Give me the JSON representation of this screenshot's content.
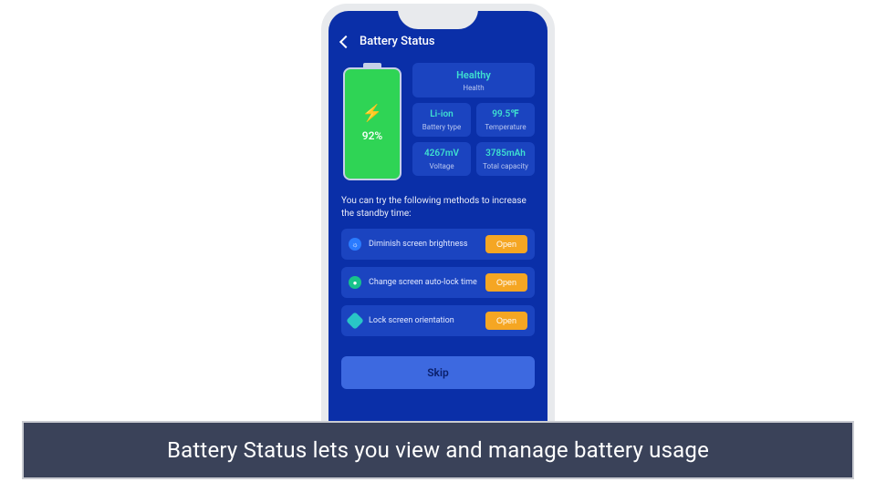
{
  "header": {
    "title": "Battery Status"
  },
  "battery": {
    "percent": "92%"
  },
  "stats": {
    "health": {
      "value": "Healthy",
      "label": "Health"
    },
    "type": {
      "value": "Li-ion",
      "label": "Battery type"
    },
    "temp": {
      "value": "99.5℉",
      "label": "Temperature"
    },
    "volt": {
      "value": "4267mV",
      "label": "Voltage"
    },
    "cap": {
      "value": "3785mAh",
      "label": "Total capacity"
    }
  },
  "tip_text": "You can try the following methods to increase the standby time:",
  "methods": [
    {
      "label": "Diminish screen brightness",
      "button": "Open"
    },
    {
      "label": "Change screen auto-lock time",
      "button": "Open"
    },
    {
      "label": "Lock screen orientation",
      "button": "Open"
    }
  ],
  "skip_label": "Skip",
  "caption": "Battery Status lets you view and manage battery usage"
}
